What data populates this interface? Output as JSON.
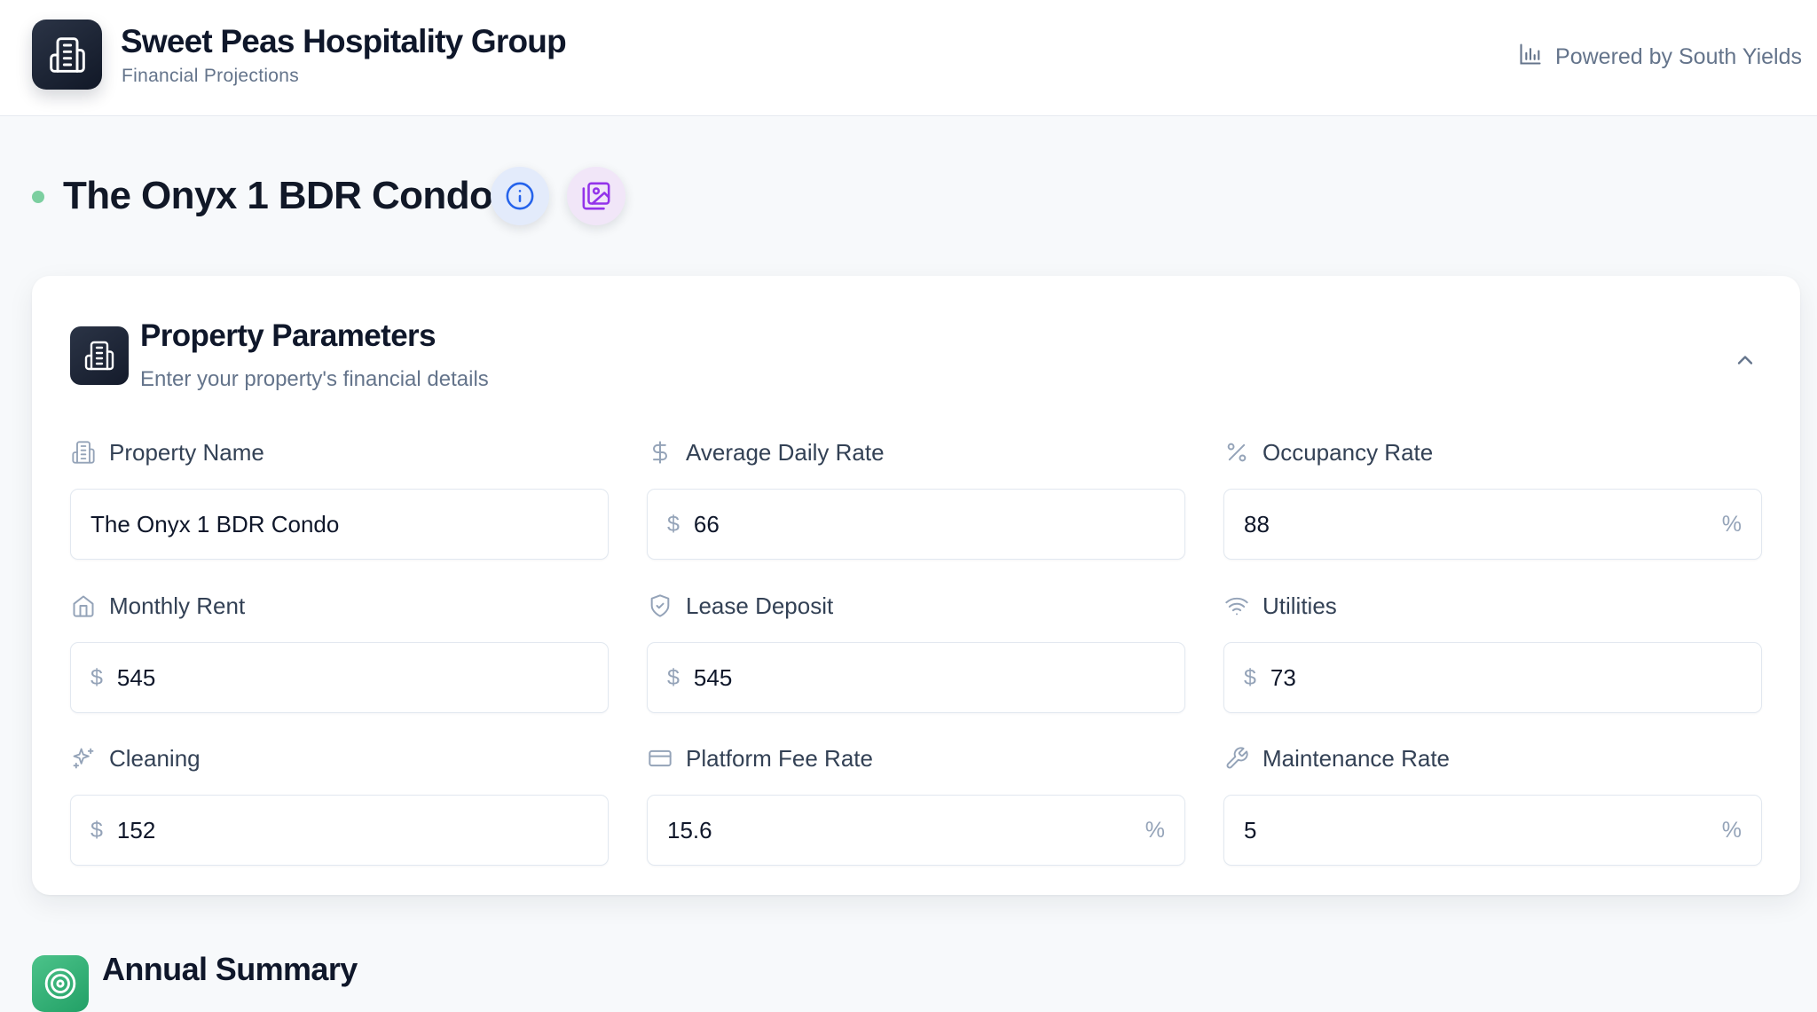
{
  "header": {
    "company": "Sweet Peas Hospitality Group",
    "subtitle": "Financial Projections",
    "powered_by": "Powered by South Yields"
  },
  "property": {
    "title": "The Onyx 1 BDR Condo"
  },
  "parameters": {
    "title": "Property Parameters",
    "subtitle": "Enter your property's financial details",
    "fields": [
      {
        "label": "Property Name",
        "icon": "building-icon",
        "prefix": "",
        "value": "The Onyx 1 BDR Condo",
        "suffix": ""
      },
      {
        "label": "Average Daily Rate",
        "icon": "dollar-icon",
        "prefix": "$",
        "value": "66",
        "suffix": ""
      },
      {
        "label": "Occupancy Rate",
        "icon": "percent-icon",
        "prefix": "",
        "value": "88",
        "suffix": "%"
      },
      {
        "label": "Monthly Rent",
        "icon": "home-icon",
        "prefix": "$",
        "value": "545",
        "suffix": ""
      },
      {
        "label": "Lease Deposit",
        "icon": "shield-icon",
        "prefix": "$",
        "value": "545",
        "suffix": ""
      },
      {
        "label": "Utilities",
        "icon": "wifi-icon",
        "prefix": "$",
        "value": "73",
        "suffix": ""
      },
      {
        "label": "Cleaning",
        "icon": "sparkles-icon",
        "prefix": "$",
        "value": "152",
        "suffix": ""
      },
      {
        "label": "Platform Fee Rate",
        "icon": "credit-card-icon",
        "prefix": "",
        "value": "15.6",
        "suffix": "%"
      },
      {
        "label": "Maintenance Rate",
        "icon": "wrench-icon",
        "prefix": "",
        "value": "5",
        "suffix": "%"
      }
    ]
  },
  "summary": {
    "title": "Annual Summary"
  },
  "colors": {
    "status_dot": "#7ccfa0",
    "dark_tile": "#1f2937",
    "summary_tile": "#34b27b",
    "info_accent": "#2563eb",
    "gallery_accent": "#9333ea"
  }
}
